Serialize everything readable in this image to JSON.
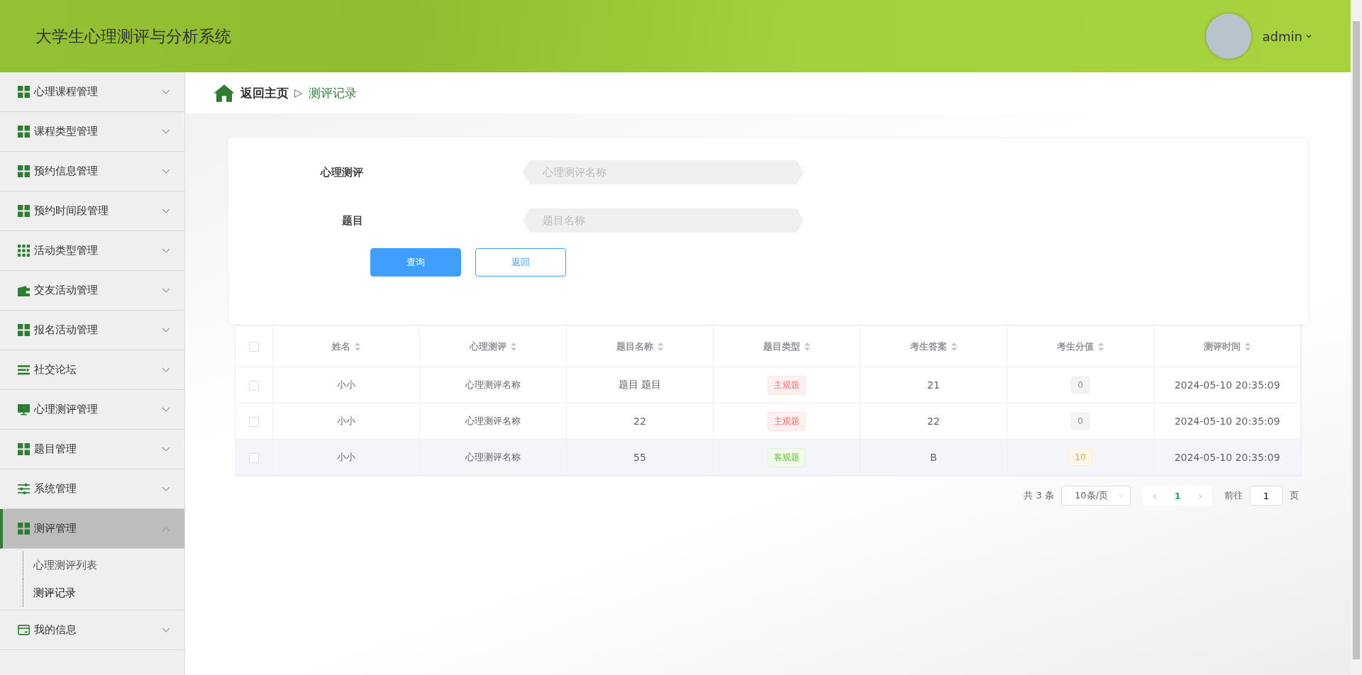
{
  "header": {
    "title": "大学生心理测评与分析系统",
    "user": "admin"
  },
  "sidebar": {
    "items": [
      {
        "label": "心理课程管理",
        "expanded": false,
        "selected": false
      },
      {
        "label": "课程类型管理",
        "expanded": false,
        "selected": false
      },
      {
        "label": "预约信息管理",
        "expanded": false,
        "selected": false
      },
      {
        "label": "预约时间段管理",
        "expanded": false,
        "selected": false
      },
      {
        "label": "活动类型管理",
        "expanded": false,
        "selected": false
      },
      {
        "label": "交友活动管理",
        "expanded": false,
        "selected": false
      },
      {
        "label": "报名活动管理",
        "expanded": false,
        "selected": false
      },
      {
        "label": "社交论坛",
        "expanded": false,
        "selected": false
      },
      {
        "label": "心理测评管理",
        "expanded": false,
        "selected": false
      },
      {
        "label": "题目管理",
        "expanded": false,
        "selected": false
      },
      {
        "label": "系统管理",
        "expanded": false,
        "selected": false
      },
      {
        "label": "测评管理",
        "expanded": true,
        "selected": true,
        "children": [
          {
            "label": "心理测评列表",
            "selected": false
          },
          {
            "label": "测评记录",
            "selected": true
          }
        ]
      },
      {
        "label": "我的信息",
        "expanded": false,
        "selected": false
      }
    ]
  },
  "breadcrumb": {
    "home": "返回主页",
    "separator": "▷",
    "current": "测评记录"
  },
  "search": {
    "fields": [
      {
        "label": "心理测评",
        "placeholder": "心理测评名称"
      },
      {
        "label": "题目",
        "placeholder": "题目名称"
      }
    ],
    "buttons": [
      {
        "label": "查询",
        "kind": "primary"
      },
      {
        "label": "返回",
        "kind": "outline"
      }
    ]
  },
  "table": {
    "select_all": {
      "checked": false
    },
    "columns": [
      "姓名",
      "心理测评",
      "题目名称",
      "题目类型",
      "考生答案",
      "考生分值",
      "测评时间"
    ],
    "rows": [
      {
        "checked": false,
        "hovered": false,
        "name": "小小",
        "assessment": "心理测评名称",
        "question": "题目 题目",
        "type": {
          "label": "主观题",
          "kind": "danger"
        },
        "answer": "21",
        "score": {
          "label": "0",
          "kind": "info"
        },
        "time": "2024-05-10 20:35:09"
      },
      {
        "checked": false,
        "hovered": false,
        "name": "小小",
        "assessment": "心理测评名称",
        "question": "22",
        "type": {
          "label": "主观题",
          "kind": "danger"
        },
        "answer": "22",
        "score": {
          "label": "0",
          "kind": "info"
        },
        "time": "2024-05-10 20:35:09"
      },
      {
        "checked": false,
        "hovered": true,
        "name": "小小",
        "assessment": "心理测评名称",
        "question": "55",
        "type": {
          "label": "客观题",
          "kind": "success"
        },
        "answer": "B",
        "score": {
          "label": "10",
          "kind": "warning"
        },
        "time": "2024-05-10 20:35:09"
      }
    ]
  },
  "pagination": {
    "total": "共 3 条",
    "page_size": "10条/页",
    "prev": "‹",
    "pages": [
      {
        "label": "1",
        "selected": true
      }
    ],
    "next": "›",
    "goto_label": "前往",
    "goto_value": "1",
    "goto_unit": "页"
  }
}
